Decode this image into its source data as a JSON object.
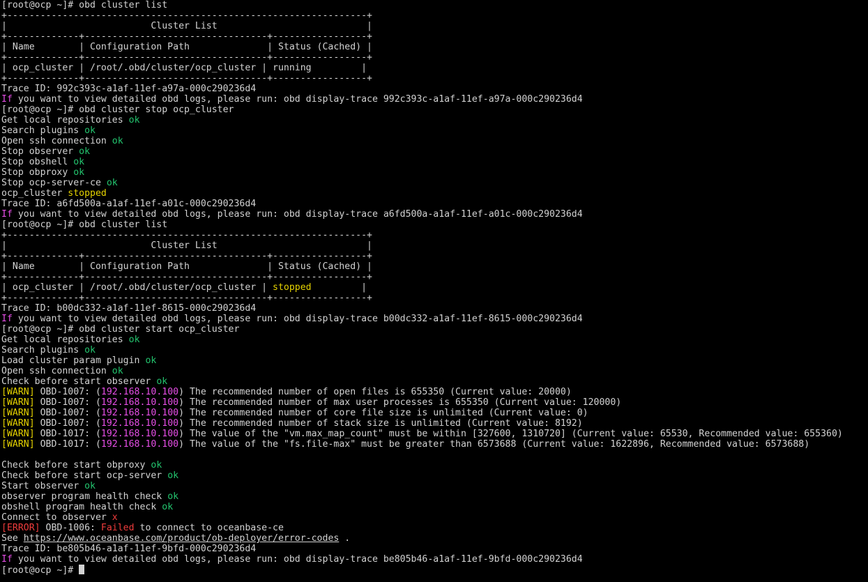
{
  "colors": {
    "background": "#000000",
    "foreground": "#d2d2d2",
    "ok": "#23c46e",
    "stopped": "#e5d200",
    "if_keyword": "#e64ee6",
    "warn": "#e5d200",
    "ip": "#e64ee6",
    "error": "#ef3c3c"
  },
  "terminal": {
    "lines": [
      [
        {
          "t": "[root@ocp ~]# obd cluster list"
        }
      ],
      [
        {
          "t": "+-----------------------------------------------------------------+"
        }
      ],
      [
        {
          "t": "|                          Cluster List                           |"
        }
      ],
      [
        {
          "t": "+-------------+---------------------------------+-----------------+"
        }
      ],
      [
        {
          "t": "| Name        | Configuration Path              | Status (Cached) |"
        }
      ],
      [
        {
          "t": "+-------------+---------------------------------+-----------------+"
        }
      ],
      [
        {
          "t": "| ocp_cluster | /root/.obd/cluster/ocp_cluster | running         |"
        }
      ],
      [
        {
          "t": "+-------------+---------------------------------+-----------------+"
        }
      ],
      [
        {
          "t": "Trace ID: 992c393c-a1af-11ef-a97a-000c290236d4"
        }
      ],
      [
        {
          "t": "If",
          "c": "magenta"
        },
        {
          "t": " you want to view detailed obd logs, please run: obd display-trace 992c393c-a1af-11ef-a97a-000c290236d4"
        }
      ],
      [
        {
          "t": "[root@ocp ~]# obd cluster stop ocp_cluster"
        }
      ],
      [
        {
          "t": "Get local repositories "
        },
        {
          "t": "ok",
          "c": "ok"
        }
      ],
      [
        {
          "t": "Search plugins "
        },
        {
          "t": "ok",
          "c": "ok"
        }
      ],
      [
        {
          "t": "Open ssh connection "
        },
        {
          "t": "ok",
          "c": "ok"
        }
      ],
      [
        {
          "t": "Stop observer "
        },
        {
          "t": "ok",
          "c": "ok"
        }
      ],
      [
        {
          "t": "Stop obshell "
        },
        {
          "t": "ok",
          "c": "ok"
        }
      ],
      [
        {
          "t": "Stop obproxy "
        },
        {
          "t": "ok",
          "c": "ok"
        }
      ],
      [
        {
          "t": "Stop ocp-server-ce "
        },
        {
          "t": "ok",
          "c": "ok"
        }
      ],
      [
        {
          "t": "ocp_cluster "
        },
        {
          "t": "stopped",
          "c": "yellow"
        }
      ],
      [
        {
          "t": "Trace ID: a6fd500a-a1af-11ef-a01c-000c290236d4"
        }
      ],
      [
        {
          "t": "If",
          "c": "magenta"
        },
        {
          "t": " you want to view detailed obd logs, please run: obd display-trace a6fd500a-a1af-11ef-a01c-000c290236d4"
        }
      ],
      [
        {
          "t": "[root@ocp ~]# obd cluster list"
        }
      ],
      [
        {
          "t": "+-----------------------------------------------------------------+"
        }
      ],
      [
        {
          "t": "|                          Cluster List                           |"
        }
      ],
      [
        {
          "t": "+-------------+---------------------------------+-----------------+"
        }
      ],
      [
        {
          "t": "| Name        | Configuration Path              | Status (Cached) |"
        }
      ],
      [
        {
          "t": "+-------------+---------------------------------+-----------------+"
        }
      ],
      [
        {
          "t": "| ocp_cluster | /root/.obd/cluster/ocp_cluster | "
        },
        {
          "t": "stopped",
          "c": "yellow"
        },
        {
          "t": "         |"
        }
      ],
      [
        {
          "t": "+-------------+---------------------------------+-----------------+"
        }
      ],
      [
        {
          "t": "Trace ID: b00dc332-a1af-11ef-8615-000c290236d4"
        }
      ],
      [
        {
          "t": "If",
          "c": "magenta"
        },
        {
          "t": " you want to view detailed obd logs, please run: obd display-trace b00dc332-a1af-11ef-8615-000c290236d4"
        }
      ],
      [
        {
          "t": "[root@ocp ~]# obd cluster start ocp_cluster"
        }
      ],
      [
        {
          "t": "Get local repositories "
        },
        {
          "t": "ok",
          "c": "ok"
        }
      ],
      [
        {
          "t": "Search plugins "
        },
        {
          "t": "ok",
          "c": "ok"
        }
      ],
      [
        {
          "t": "Load cluster param plugin "
        },
        {
          "t": "ok",
          "c": "ok"
        }
      ],
      [
        {
          "t": "Open ssh connection "
        },
        {
          "t": "ok",
          "c": "ok"
        }
      ],
      [
        {
          "t": "Check before start observer "
        },
        {
          "t": "ok",
          "c": "ok"
        }
      ],
      [
        {
          "t": "[WARN]",
          "c": "yellow"
        },
        {
          "t": " OBD-1007: ("
        },
        {
          "t": "192.168.10.100",
          "c": "magenta"
        },
        {
          "t": ") The recommended number of open files is 655350 (Current value: 20000)"
        }
      ],
      [
        {
          "t": "[WARN]",
          "c": "yellow"
        },
        {
          "t": " OBD-1007: ("
        },
        {
          "t": "192.168.10.100",
          "c": "magenta"
        },
        {
          "t": ") The recommended number of max user processes is 655350 (Current value: 120000)"
        }
      ],
      [
        {
          "t": "[WARN]",
          "c": "yellow"
        },
        {
          "t": " OBD-1007: ("
        },
        {
          "t": "192.168.10.100",
          "c": "magenta"
        },
        {
          "t": ") The recommended number of core file size is unlimited (Current value: 0)"
        }
      ],
      [
        {
          "t": "[WARN]",
          "c": "yellow"
        },
        {
          "t": " OBD-1007: ("
        },
        {
          "t": "192.168.10.100",
          "c": "magenta"
        },
        {
          "t": ") The recommended number of stack size is unlimited (Current value: 8192)"
        }
      ],
      [
        {
          "t": "[WARN]",
          "c": "yellow"
        },
        {
          "t": " OBD-1017: ("
        },
        {
          "t": "192.168.10.100",
          "c": "magenta"
        },
        {
          "t": ") The value of the \"vm.max_map_count\" must be within [327600, 1310720] (Current value: 65530, Recommended value: 655360)"
        }
      ],
      [
        {
          "t": "[WARN]",
          "c": "yellow"
        },
        {
          "t": " OBD-1017: ("
        },
        {
          "t": "192.168.10.100",
          "c": "magenta"
        },
        {
          "t": ") The value of the \"fs.file-max\" must be greater than 6573688 (Current value: 1622896, Recommended value: 6573688)"
        }
      ],
      [
        {
          "t": ""
        }
      ],
      [
        {
          "t": "Check before start obproxy "
        },
        {
          "t": "ok",
          "c": "ok"
        }
      ],
      [
        {
          "t": "Check before start ocp-server "
        },
        {
          "t": "ok",
          "c": "ok"
        }
      ],
      [
        {
          "t": "Start observer "
        },
        {
          "t": "ok",
          "c": "ok"
        }
      ],
      [
        {
          "t": "observer program health check "
        },
        {
          "t": "ok",
          "c": "ok"
        }
      ],
      [
        {
          "t": "obshell program health check "
        },
        {
          "t": "ok",
          "c": "ok"
        }
      ],
      [
        {
          "t": "Connect to observer "
        },
        {
          "t": "x",
          "c": "red"
        }
      ],
      [
        {
          "t": "[ERROR]",
          "c": "red"
        },
        {
          "t": " OBD-1006: "
        },
        {
          "t": "Failed",
          "c": "red"
        },
        {
          "t": " to connect to oceanbase-ce"
        }
      ],
      [
        {
          "t": "See "
        },
        {
          "t": "https://www.oceanbase.com/product/ob-deployer/error-codes",
          "c": "link"
        },
        {
          "t": " ."
        }
      ],
      [
        {
          "t": "Trace ID: be805b46-a1af-11ef-9bfd-000c290236d4"
        }
      ],
      [
        {
          "t": "If",
          "c": "magenta"
        },
        {
          "t": " you want to view detailed obd logs, please run: obd display-trace be805b46-a1af-11ef-9bfd-000c290236d4"
        }
      ]
    ],
    "prompt": "[root@ocp ~]# "
  }
}
